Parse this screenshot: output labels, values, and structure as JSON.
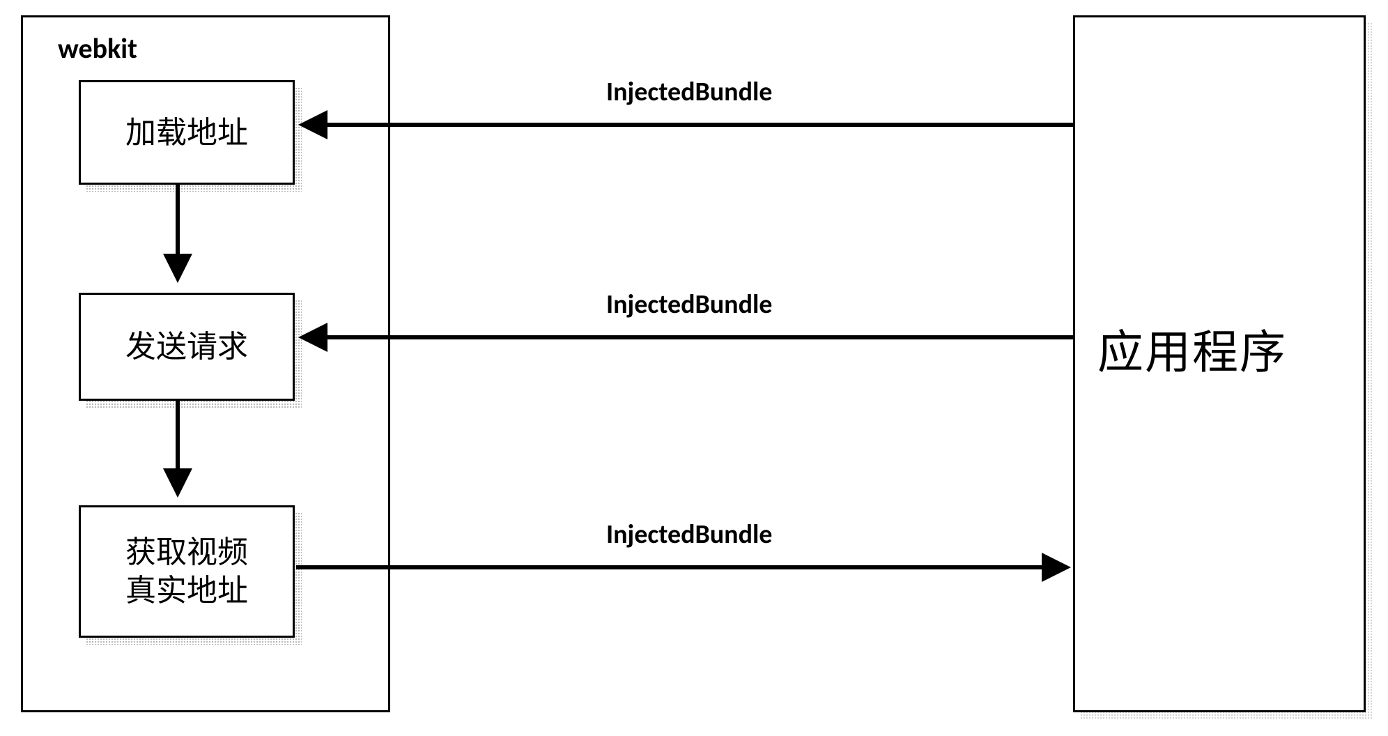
{
  "diagram": {
    "left_frame_label": "webkit",
    "steps": {
      "s1": "加载地址",
      "s2": "发送请求",
      "s3_line1": "获取视频",
      "s3_line2": "真实地址"
    },
    "right_frame_label": "应用程序",
    "arrows": {
      "a1_label": "InjectedBundle",
      "a2_label": "InjectedBundle",
      "a3_label": "InjectedBundle"
    }
  },
  "chart_data": {
    "type": "flow-diagram",
    "left_container": "webkit",
    "right_container": "应用程序",
    "nodes": [
      {
        "id": "s1",
        "label": "加载地址",
        "container": "webkit"
      },
      {
        "id": "s2",
        "label": "发送请求",
        "container": "webkit"
      },
      {
        "id": "s3",
        "label": "获取视频真实地址",
        "container": "webkit"
      },
      {
        "id": "app",
        "label": "应用程序",
        "container": "right"
      }
    ],
    "edges": [
      {
        "from": "app",
        "to": "s1",
        "label": "InjectedBundle",
        "direction": "left"
      },
      {
        "from": "s1",
        "to": "s2",
        "label": "",
        "direction": "down"
      },
      {
        "from": "app",
        "to": "s2",
        "label": "InjectedBundle",
        "direction": "left"
      },
      {
        "from": "s2",
        "to": "s3",
        "label": "",
        "direction": "down"
      },
      {
        "from": "s3",
        "to": "app",
        "label": "InjectedBundle",
        "direction": "right"
      }
    ]
  }
}
